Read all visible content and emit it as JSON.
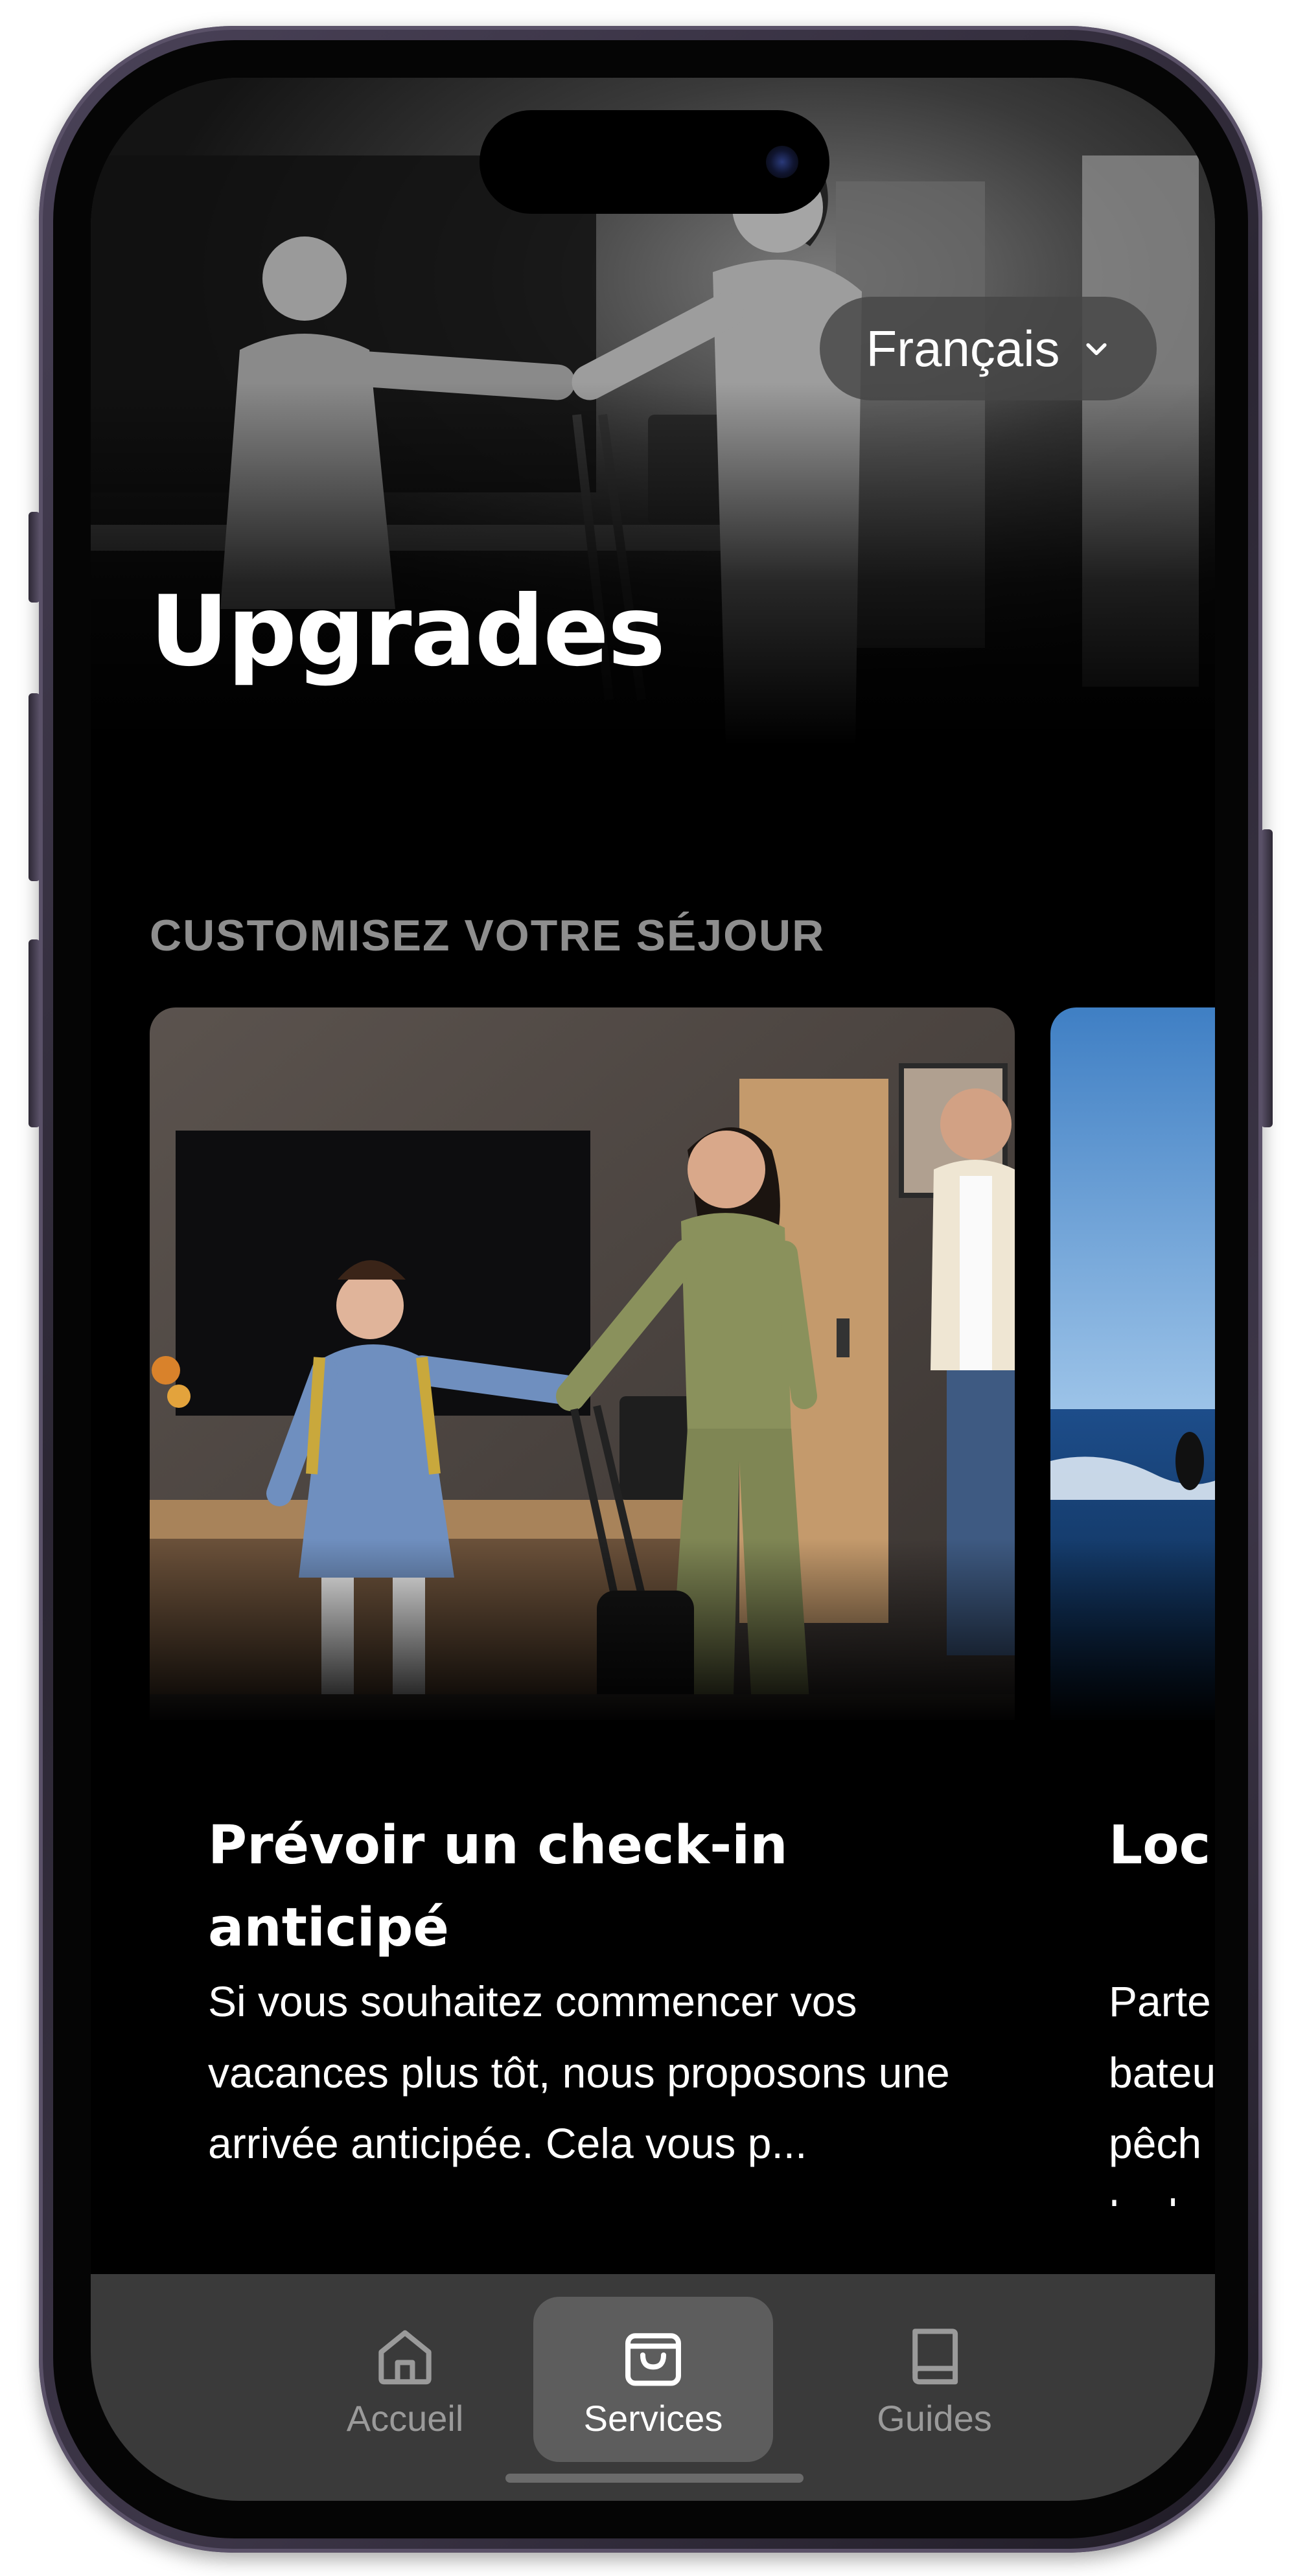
{
  "header": {
    "language": "Français",
    "title": "Upgrades"
  },
  "section": {
    "heading": "CUSTOMISEZ VOTRE SÉJOUR"
  },
  "cards": [
    {
      "title": "Prévoir un check-in anticipé",
      "description": "Si vous souhaitez commencer vos vacances plus tôt, nous proposons une arrivée anticipée. Cela vous p..."
    },
    {
      "title": "Loc",
      "description_lines": [
        "Parte",
        "bateu",
        "pêch",
        "Le bo"
      ]
    }
  ],
  "tab_bar": {
    "items": [
      {
        "label": "Accueil",
        "icon": "home-icon",
        "selected": false
      },
      {
        "label": "Services",
        "icon": "shopping-bag-icon",
        "selected": true
      },
      {
        "label": "Guides",
        "icon": "book-icon",
        "selected": false
      }
    ]
  },
  "colors": {
    "background": "#000000",
    "tab_bar": "#3a3a3a",
    "tab_selected": "#5d5d5d",
    "section_heading": "#8e8e8e"
  }
}
